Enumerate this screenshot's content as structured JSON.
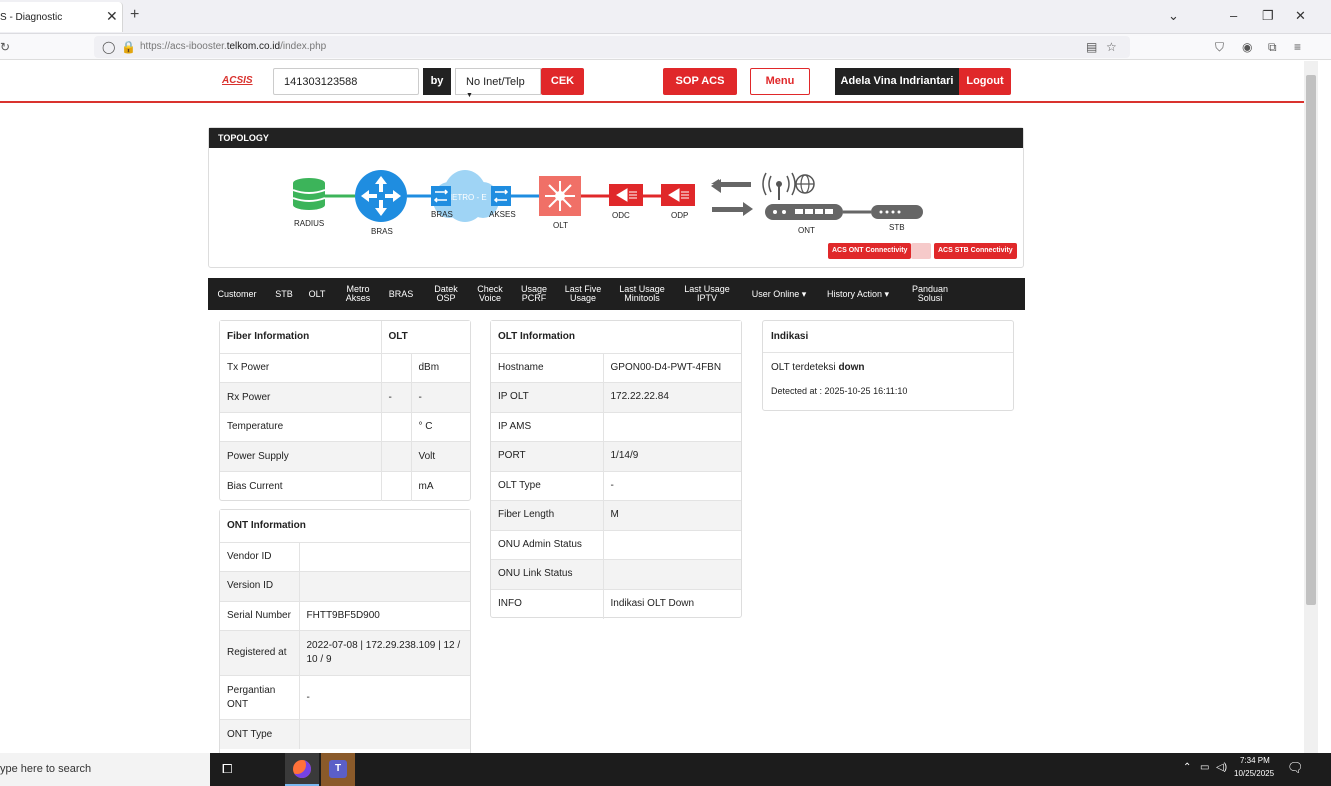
{
  "browser": {
    "tab_title": "S - Diagnostic",
    "url_prefix": "https://acs-ibooster.",
    "url_host": "telkom.co.id",
    "url_path": "/index.php"
  },
  "header": {
    "logo": "ACSIS",
    "search_value": "141303123588",
    "by_label": "by",
    "select_value": "No Inet/Telp",
    "check_label": "CEK",
    "sop_label": "SOP ACS",
    "menu_label": "Menu",
    "user_name": "Adela Vina Indriantari",
    "logout_label": "Logout"
  },
  "topology": {
    "title": "TOPOLOGY",
    "nodes": {
      "radius": "RADIUS",
      "bras": "BRAS",
      "bras2": "BRAS",
      "metro": "METRO - E",
      "akses": "AKSES",
      "olt": "OLT",
      "odc": "ODC",
      "odp": "ODP",
      "ont": "ONT",
      "stb": "STB"
    },
    "ont_connectivity": "ACS ONT Connectivity",
    "stb_connectivity": "ACS STB Connectivity"
  },
  "menu": [
    {
      "l1": "Customer",
      "l2": ""
    },
    {
      "l1": "STB",
      "l2": ""
    },
    {
      "l1": "OLT",
      "l2": ""
    },
    {
      "l1": "Metro",
      "l2": "Akses"
    },
    {
      "l1": "BRAS",
      "l2": ""
    },
    {
      "l1": "Datek",
      "l2": "OSP"
    },
    {
      "l1": "Check",
      "l2": "Voice"
    },
    {
      "l1": "Usage",
      "l2": "PCRF"
    },
    {
      "l1": "Last Five",
      "l2": "Usage"
    },
    {
      "l1": "Last Usage",
      "l2": "Minitools"
    },
    {
      "l1": "Last Usage",
      "l2": "IPTV"
    },
    {
      "l1": "User Online ▾",
      "l2": ""
    },
    {
      "l1": "History Action ▾",
      "l2": ""
    },
    {
      "l1": "Panduan",
      "l2": "Solusi"
    }
  ],
  "fiber": {
    "title": "Fiber Information",
    "col_olt": "OLT",
    "rows": [
      {
        "label": "Tx Power",
        "v1": "",
        "v2": "dBm"
      },
      {
        "label": "Rx Power",
        "v1": "-",
        "v2": "-"
      },
      {
        "label": "Temperature",
        "v1": "",
        "v2": "° C"
      },
      {
        "label": "Power Supply",
        "v1": "",
        "v2": "Volt"
      },
      {
        "label": "Bias Current",
        "v1": "",
        "v2": "mA"
      }
    ]
  },
  "ont": {
    "title": "ONT Information",
    "rows": [
      {
        "label": "Vendor ID",
        "value": ""
      },
      {
        "label": "Version ID",
        "value": ""
      },
      {
        "label": "Serial Number",
        "value": "FHTT9BF5D900"
      },
      {
        "label": "Registered at",
        "value": "2022-07-08 | 172.29.238.109 | 12 / 10 / 9"
      },
      {
        "label": "Pergantian ONT",
        "value": "-"
      },
      {
        "label": "ONT Type",
        "value": ""
      }
    ]
  },
  "olt": {
    "title": "OLT Information",
    "rows": [
      {
        "label": "Hostname",
        "value": "GPON00-D4-PWT-4FBN"
      },
      {
        "label": "IP OLT",
        "value": "172.22.22.84"
      },
      {
        "label": "IP AMS",
        "value": ""
      },
      {
        "label": "PORT",
        "value": "1/14/9"
      },
      {
        "label": "OLT Type",
        "value": "-"
      },
      {
        "label": "Fiber Length",
        "value": "M"
      },
      {
        "label": "ONU Admin Status",
        "value": ""
      },
      {
        "label": "ONU Link Status",
        "value": ""
      },
      {
        "label": "INFO",
        "value": "Indikasi OLT Down"
      }
    ]
  },
  "indikasi": {
    "title": "Indikasi",
    "line1_prefix": "OLT terdeteksi ",
    "line1_bold": "down",
    "line2": "Detected at : 2025-10-25 16:11:10"
  },
  "taskbar": {
    "search_placeholder": "ype here to search",
    "time": "7:34 PM",
    "date": "10/25/2025"
  },
  "colors": {
    "accent": "#e0282a",
    "dark": "#1f1f1f"
  }
}
